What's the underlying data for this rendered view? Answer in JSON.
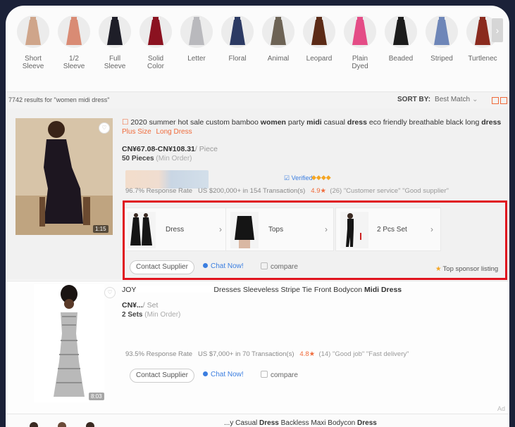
{
  "categories": [
    {
      "label": "Short\nSleeve",
      "icon": "short-sleeve-dress-thumb"
    },
    {
      "label": "1/2\nSleeve",
      "icon": "half-sleeve-dress-thumb"
    },
    {
      "label": "Full\nSleeve",
      "icon": "full-sleeve-dress-thumb"
    },
    {
      "label": "Solid\nColor",
      "icon": "solid-color-dress-thumb"
    },
    {
      "label": "Letter",
      "icon": "letter-dress-thumb"
    },
    {
      "label": "Floral",
      "icon": "floral-dress-thumb"
    },
    {
      "label": "Animal",
      "icon": "animal-dress-thumb"
    },
    {
      "label": "Leopard",
      "icon": "leopard-dress-thumb"
    },
    {
      "label": "Plain\nDyed",
      "icon": "plain-dyed-dress-thumb"
    },
    {
      "label": "Beaded",
      "icon": "beaded-dress-thumb"
    },
    {
      "label": "Striped",
      "icon": "striped-dress-thumb"
    },
    {
      "label": "Turtlenec",
      "icon": "turtleneck-dress-thumb"
    }
  ],
  "results": {
    "count_text": "7742 results for \"women midi dress\"",
    "sort_label": "SORT BY:",
    "sort_value": "Best Match",
    "sort_chevron": "⌄"
  },
  "listing1": {
    "title_parts": [
      "2020 summer hot sale custom bamboo ",
      "women",
      " party ",
      "midi",
      " casual ",
      "dress",
      " eco friendly breathable black long ",
      "dress"
    ],
    "tag1": "Plus Size",
    "tag2": "Long Dress",
    "price": "CN¥67.08-CN¥108.31",
    "price_unit": "/ Piece",
    "moq": "50 Pieces",
    "moq_note": "(Min Order)",
    "verified": "Verified",
    "response_rate": "96.7% Response Rate",
    "transactions": "US $200,000+ in 154 Transaction(s)",
    "rating": "4.9★",
    "reviews": "(26) \"Customer service\" \"Good supplier\"",
    "video_badge": "1:15",
    "subcats": [
      {
        "name": "Dress",
        "arrow": "›"
      },
      {
        "name": "Tops",
        "arrow": "›"
      },
      {
        "name": "2 Pcs Set",
        "arrow": "›"
      }
    ],
    "contact": "Contact Supplier",
    "chat": "Chat Now!",
    "compare": "compare",
    "sponsor": "Top sponsor listing"
  },
  "listing2": {
    "title_start": "JOY",
    "title_rest": "Dresses Sleeveless Stripe Tie Front Bodycon ",
    "title_kw": "Midi Dress",
    "price": "CN¥...",
    "price_unit": "/ Set",
    "moq": "2 Sets",
    "moq_note": "(Min Order)",
    "response_rate": "93.5% Response Rate",
    "transactions": "US $7,000+ in 70 Transaction(s)",
    "rating": "4.8★",
    "reviews": "(14) \"Good job\" \"Fast delivery\"",
    "contact": "Contact Supplier",
    "chat": "Chat Now!",
    "compare": "compare",
    "video_badge": "8:03",
    "ad": "Ad"
  },
  "listing3": {
    "title_rest": "...y Casual ",
    "kw1": "Dress",
    "mid": " Backless Maxi Bodycon ",
    "kw2": "Dress"
  },
  "colors": {
    "accent": "#f06a3a",
    "highlight": "#e0141e",
    "link": "#3b7ee0"
  }
}
